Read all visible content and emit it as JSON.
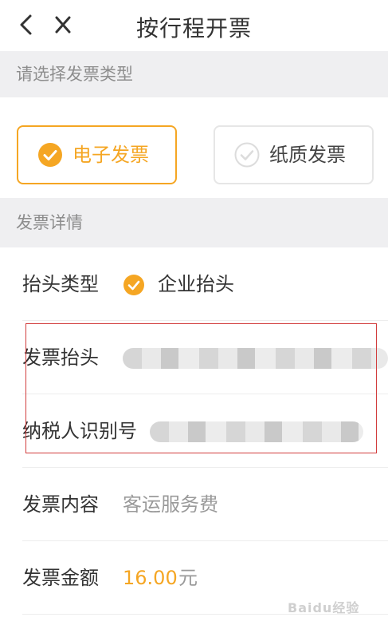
{
  "nav": {
    "title": "按行程开票",
    "back_icon": "chevron-left-icon",
    "close_icon": "close-icon"
  },
  "section_type": {
    "header": "请选择发票类型",
    "options": [
      {
        "label": "电子发票",
        "selected": true
      },
      {
        "label": "纸质发票",
        "selected": false
      }
    ]
  },
  "section_details": {
    "header": "发票详情",
    "rows": {
      "title_type": {
        "label": "抬头类型",
        "value": "企业抬头"
      },
      "invoice_title": {
        "label": "发票抬头"
      },
      "tax_id": {
        "label": "纳税人识别号"
      },
      "content": {
        "label": "发票内容",
        "value": "客运服务费"
      },
      "amount": {
        "label": "发票金额",
        "value": "16.00",
        "unit": "元"
      }
    }
  },
  "colors": {
    "accent": "#f5a623",
    "section_bg": "#efeff1",
    "annotation": "#d23c3c"
  },
  "watermark": {
    "text": "Baidu经验"
  }
}
